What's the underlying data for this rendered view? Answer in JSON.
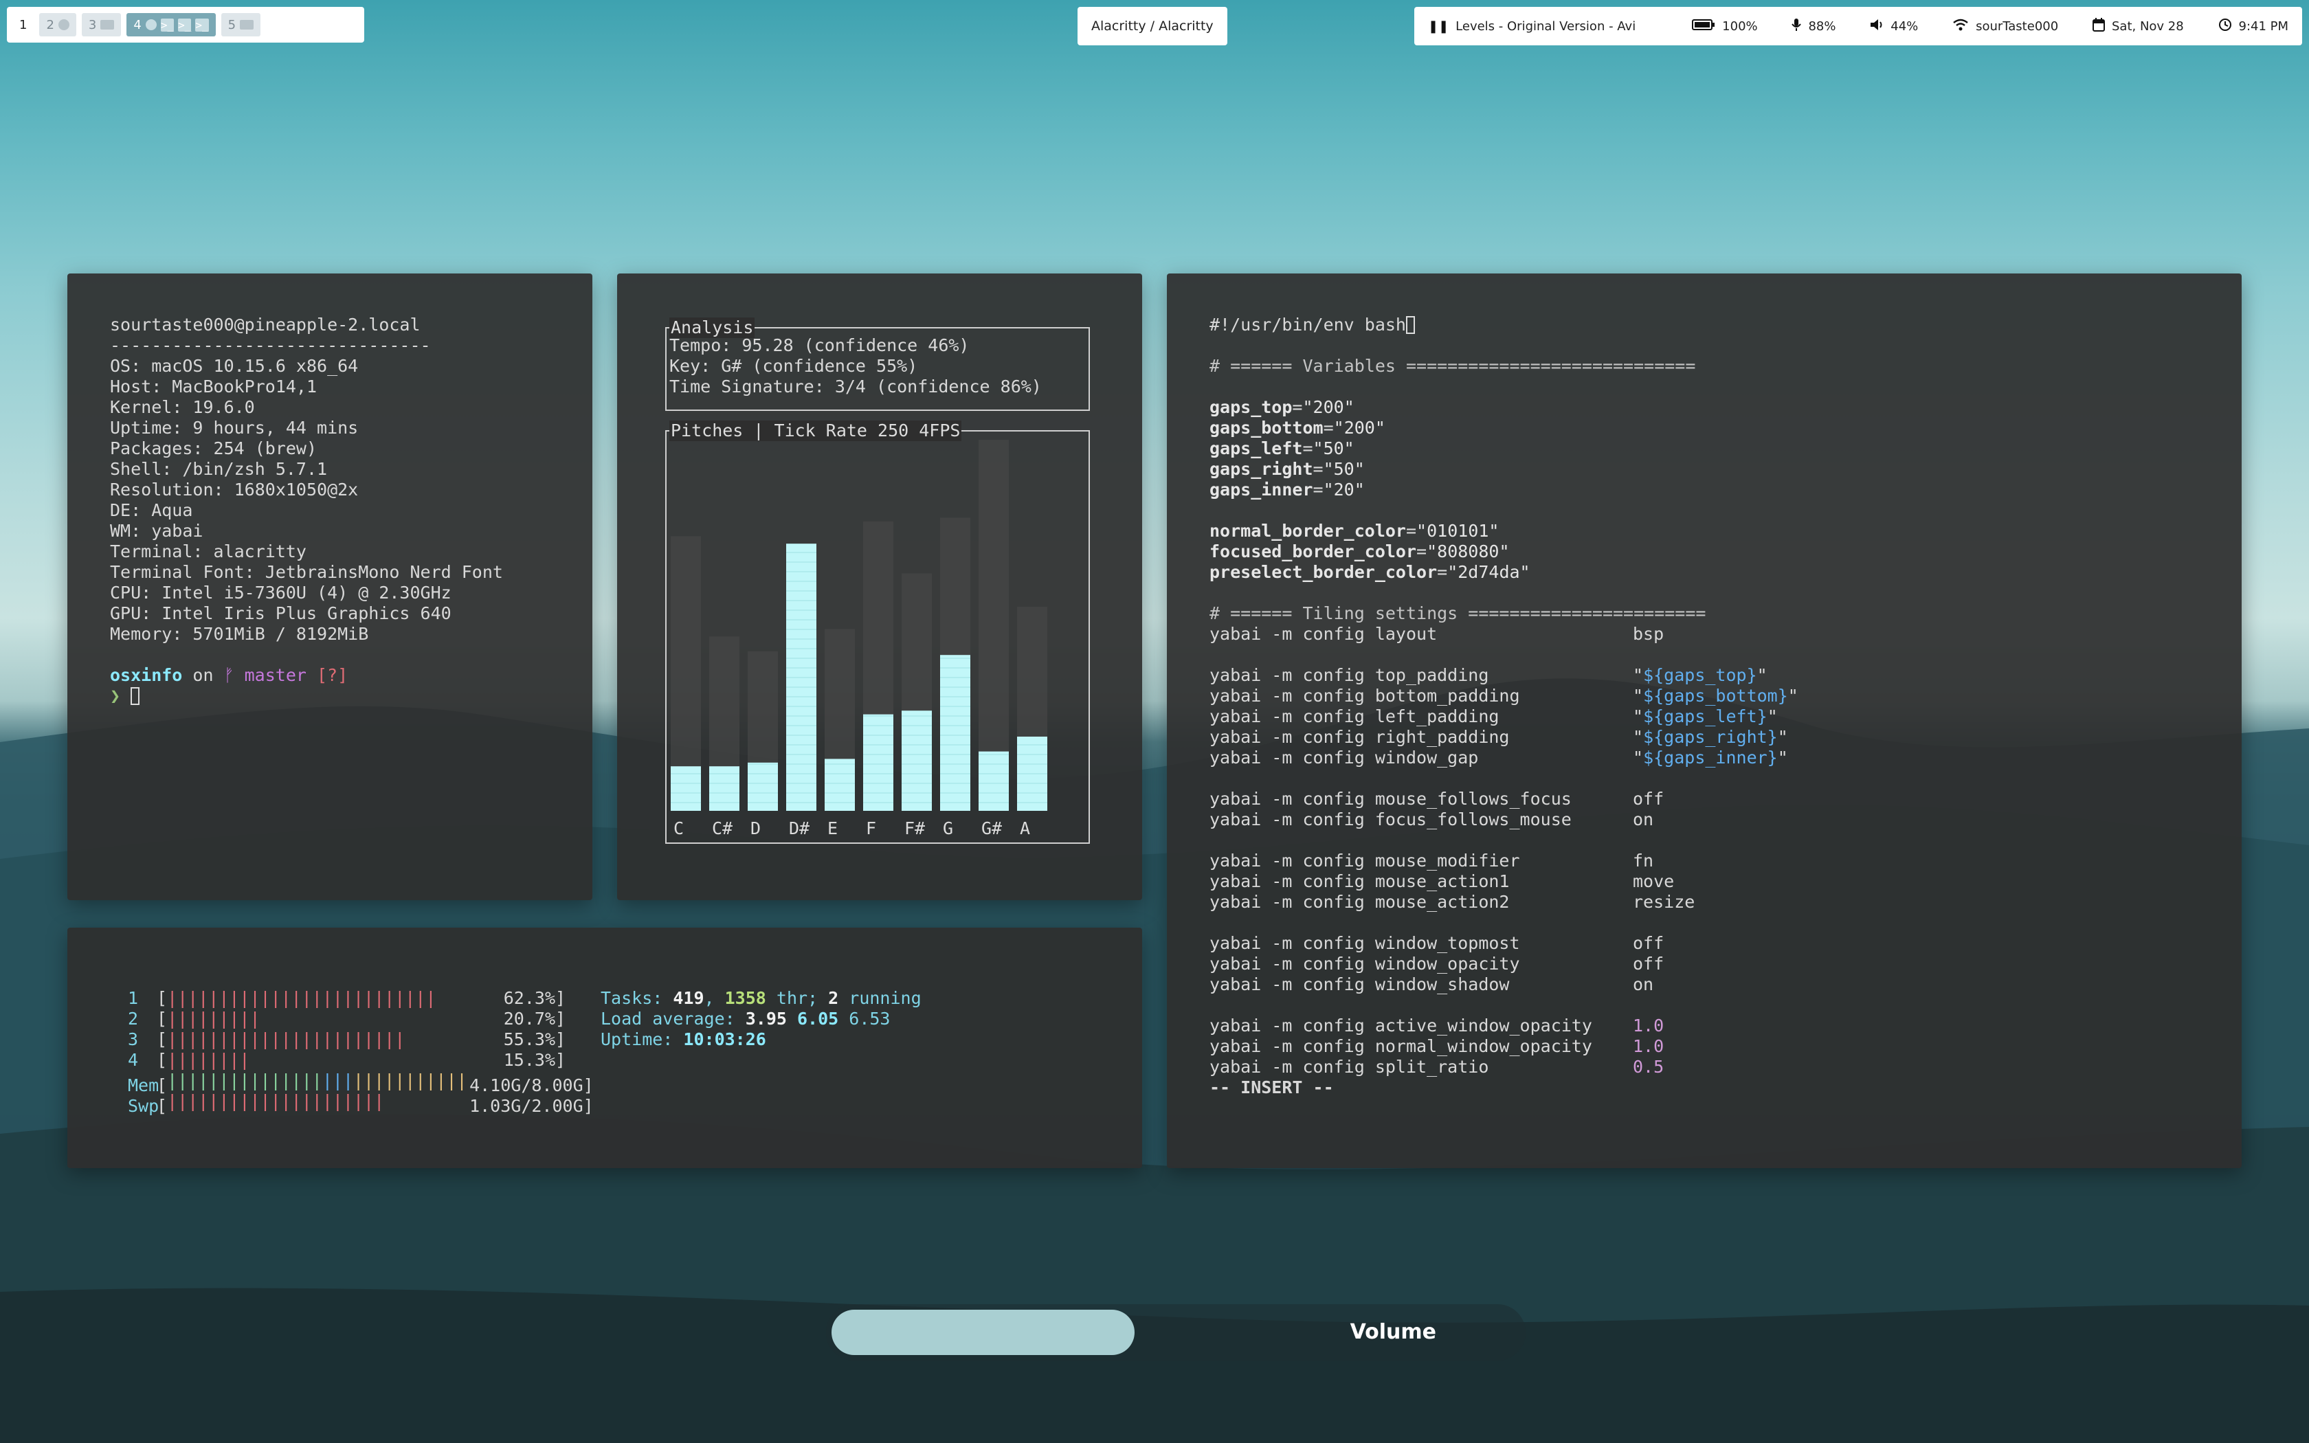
{
  "spaces": [
    {
      "label": "1",
      "state": "current"
    },
    {
      "label": "2",
      "state": "dim",
      "icon": "circle"
    },
    {
      "label": "3",
      "state": "dim",
      "icon": "window"
    },
    {
      "label": "4",
      "state": "active",
      "icon": "terminal"
    },
    {
      "label": "5",
      "state": "dim",
      "icon": "window"
    }
  ],
  "window_title": "Alacritty / Alacritty",
  "status": {
    "music": "Levels - Original Version - Avi",
    "battery": "100%",
    "mic": "88%",
    "volume": "44%",
    "wifi": "sourTaste000",
    "date": "Sat, Nov 28",
    "time": "9:41 PM"
  },
  "neofetch": {
    "header": "sourtaste000@pineapple-2.local",
    "rule": "-------------------------------",
    "lines": [
      "OS: macOS 10.15.6 x86_64",
      "Host: MacBookPro14,1",
      "Kernel: 19.6.0",
      "Uptime: 9 hours, 44 mins",
      "Packages: 254 (brew)",
      "Shell: /bin/zsh 5.7.1",
      "Resolution: 1680x1050@2x",
      "DE: Aqua",
      "WM: yabai",
      "Terminal: alacritty",
      "Terminal Font: JetbrainsMono Nerd Font",
      "CPU: Intel i5-7360U (4) @ 2.30GHz",
      "GPU: Intel Iris Plus Graphics 640",
      "Memory: 5701MiB / 8192MiB"
    ],
    "prompt_dir": "osxinfo",
    "prompt_on": " on ",
    "prompt_branch": "ᚠ master",
    "prompt_status": " [?]",
    "prompt_symbol": "❯"
  },
  "analysis": {
    "title": "Analysis",
    "lines": [
      "Tempo: 95.28 (confidence 46%)",
      "Key: G# (confidence 55%)",
      "Time Signature: 3/4 (confidence 86%)"
    ],
    "pitch_title": "Pitches | Tick Rate 250 4FPS"
  },
  "chart_data": {
    "type": "bar",
    "categories": [
      "C",
      "C#",
      "D",
      "D#",
      "E",
      "F",
      "F#",
      "G",
      "G#",
      "A"
    ],
    "series": [
      {
        "values": [
          0.12,
          0.12,
          0.13,
          0.72,
          0.14,
          0.26,
          0.27,
          0.42,
          0.16,
          0.2
        ]
      },
      {
        "values": [
          0.74,
          0.47,
          0.43,
          0.66,
          0.49,
          0.78,
          0.64,
          0.79,
          1.0,
          0.55
        ]
      }
    ],
    "colors": {
      "current": "#c2f7f9",
      "peak": "#4a4a4a"
    },
    "ylim": [
      0,
      1
    ]
  },
  "vim": {
    "shebang": "#!/usr/bin/env bash",
    "comment1": "# ====== Variables ============================",
    "gaps": [
      {
        "k": "gaps_top",
        "v": "\"200\""
      },
      {
        "k": "gaps_bottom",
        "v": "\"200\""
      },
      {
        "k": "gaps_left",
        "v": "\"50\""
      },
      {
        "k": "gaps_right",
        "v": "\"50\""
      },
      {
        "k": "gaps_inner",
        "v": "\"20\""
      }
    ],
    "colors": [
      {
        "k": "normal_border_color",
        "v": "\"010101\""
      },
      {
        "k": "focused_border_color",
        "v": "\"808080\""
      },
      {
        "k": "preselect_border_color",
        "v": "\"2d74da\""
      }
    ],
    "comment2": "# ====== Tiling settings =======================",
    "layout": {
      "cmd": "yabai -m config layout",
      "val": "bsp"
    },
    "padding": [
      {
        "cmd": "yabai -m config top_padding",
        "pre": "\"",
        "var": "${gaps_top}",
        "post": "\""
      },
      {
        "cmd": "yabai -m config bottom_padding",
        "pre": "\"",
        "var": "${gaps_bottom}",
        "post": "\""
      },
      {
        "cmd": "yabai -m config left_padding",
        "pre": "\"",
        "var": "${gaps_left}",
        "post": "\""
      },
      {
        "cmd": "yabai -m config right_padding",
        "pre": "\"",
        "var": "${gaps_right}",
        "post": "\""
      },
      {
        "cmd": "yabai -m config window_gap",
        "pre": "\"",
        "var": "${gaps_inner}",
        "post": "\""
      }
    ],
    "mouse1": [
      {
        "cmd": "yabai -m config mouse_follows_focus",
        "val": "off"
      },
      {
        "cmd": "yabai -m config focus_follows_mouse",
        "val": "on"
      }
    ],
    "mouse2": [
      {
        "cmd": "yabai -m config mouse_modifier",
        "val": "fn"
      },
      {
        "cmd": "yabai -m config mouse_action1",
        "val": "move"
      },
      {
        "cmd": "yabai -m config mouse_action2",
        "val": "resize"
      }
    ],
    "window": [
      {
        "cmd": "yabai -m config window_topmost",
        "val": "off"
      },
      {
        "cmd": "yabai -m config window_opacity",
        "val": "off"
      },
      {
        "cmd": "yabai -m config window_shadow",
        "val": "on"
      }
    ],
    "opacity": [
      {
        "cmd": "yabai -m config active_window_opacity",
        "val": "1.0"
      },
      {
        "cmd": "yabai -m config normal_window_opacity",
        "val": "1.0"
      },
      {
        "cmd": "yabai -m config split_ratio",
        "val": "0.5"
      }
    ],
    "mode": "-- INSERT --"
  },
  "htop": {
    "cpus": [
      {
        "n": "1",
        "bar": "||||||||||||||||||||||||||",
        "pct": "62.3%]"
      },
      {
        "n": "2",
        "bar": "|||||||||",
        "pct": "20.7%]"
      },
      {
        "n": "3",
        "bar": "|||||||||||||||||||||||",
        "pct": "55.3%]"
      },
      {
        "n": "4",
        "bar": "||||||||",
        "pct": "15.3%]"
      }
    ],
    "mem": {
      "label": "Mem",
      "bar": "||||||||||||||||||||||||||||||",
      "value": "4.10G/8.00G]"
    },
    "swp": {
      "label": "Swp",
      "bar": "|||||||||||||||||||||",
      "value": "1.03G/2.00G]"
    },
    "tasks_label": "Tasks: ",
    "tasks": "419",
    "tasks_sep": ", ",
    "thr": "1358",
    "thr_label": " thr; ",
    "running": "2",
    "running_label": " running",
    "load_label": "Load average: ",
    "load1": "3.95",
    "load5": "6.05",
    "load15": "6.53",
    "uptime_label": "Uptime: ",
    "uptime": "10:03:26"
  },
  "volume_osd": {
    "label": "Volume",
    "level": 0.44
  }
}
